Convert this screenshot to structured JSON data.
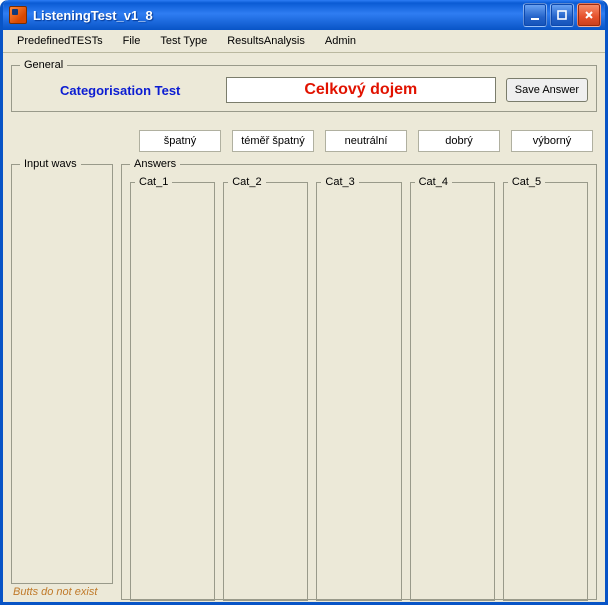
{
  "window": {
    "title": "ListeningTest_v1_8"
  },
  "menu": {
    "items": [
      {
        "label": "PredefinedTESTs"
      },
      {
        "label": "File"
      },
      {
        "label": "Test Type"
      },
      {
        "label": "ResultsAnalysis"
      },
      {
        "label": "Admin"
      }
    ]
  },
  "general": {
    "legend": "General",
    "label": "Categorisation Test",
    "input_value": "Celkový dojem",
    "save_label": "Save Answer"
  },
  "category_buttons": [
    {
      "label": "špatný"
    },
    {
      "label": "téměř špatný"
    },
    {
      "label": "neutrální"
    },
    {
      "label": "dobrý"
    },
    {
      "label": "výborný"
    }
  ],
  "input_wavs": {
    "legend": "Input wavs"
  },
  "answers": {
    "legend": "Answers",
    "columns": [
      {
        "label": "Cat_1"
      },
      {
        "label": "Cat_2"
      },
      {
        "label": "Cat_3"
      },
      {
        "label": "Cat_4"
      },
      {
        "label": "Cat_5"
      }
    ]
  },
  "status": {
    "text": "Butts do not exist"
  }
}
